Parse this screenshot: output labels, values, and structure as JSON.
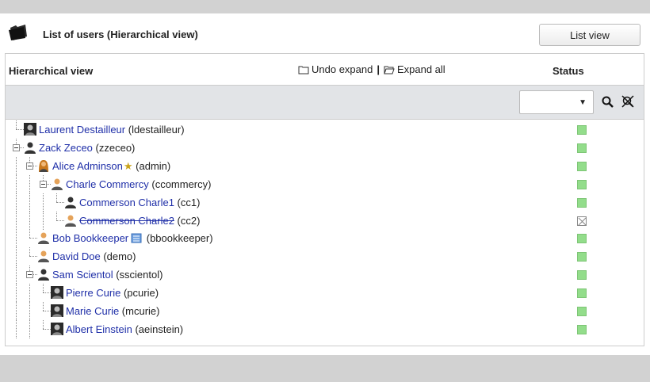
{
  "header": {
    "title": "List of users (Hierarchical view)",
    "list_view_label": "List view"
  },
  "table": {
    "col_hierarchical": "Hierarchical view",
    "undo_expand": "Undo expand",
    "separator": "|",
    "expand_all": "Expand all",
    "col_status": "Status",
    "status_filter_value": ""
  },
  "users": [
    {
      "name": "Laurent Destailleur",
      "login": "(ldestailleur)",
      "level": 0,
      "avatar": "photo-avatar-icon",
      "status": "enabled"
    },
    {
      "name": "Zack Zeceo",
      "login": "(zzeceo)",
      "level": 0,
      "avatar": "user-dark-icon",
      "status": "enabled",
      "expanded": true
    },
    {
      "name": "Alice Adminson",
      "login": "(admin)",
      "level": 1,
      "avatar": "user-female-icon",
      "status": "enabled",
      "expanded": true,
      "badge": "admin-star-icon"
    },
    {
      "name": "Charle Commercy",
      "login": "(ccommercy)",
      "level": 2,
      "avatar": "user-orange-icon",
      "status": "enabled",
      "expanded": true
    },
    {
      "name": "Commerson Charle1",
      "login": "(cc1)",
      "level": 3,
      "avatar": "user-dark-icon",
      "status": "enabled"
    },
    {
      "name": "Commerson Charle2",
      "login": "(cc2)",
      "level": 3,
      "avatar": "user-orange-icon",
      "status": "disabled"
    },
    {
      "name": "Bob Bookkeeper",
      "login": "(bbookkeeper)",
      "level": 1,
      "avatar": "user-orange-icon",
      "status": "enabled",
      "badge": "accountant-icon"
    },
    {
      "name": "David Doe",
      "login": "(demo)",
      "level": 1,
      "avatar": "user-orange-icon",
      "status": "enabled"
    },
    {
      "name": "Sam Scientol",
      "login": "(sscientol)",
      "level": 1,
      "avatar": "user-dark-icon",
      "status": "enabled",
      "expanded": true
    },
    {
      "name": "Pierre Curie",
      "login": "(pcurie)",
      "level": 2,
      "avatar": "photo-avatar-icon",
      "status": "enabled"
    },
    {
      "name": "Marie Curie",
      "login": "(mcurie)",
      "level": 2,
      "avatar": "photo-avatar-icon",
      "status": "enabled"
    },
    {
      "name": "Albert Einstein",
      "login": "(aeinstein)",
      "level": 2,
      "avatar": "photo-avatar-icon",
      "status": "enabled"
    }
  ],
  "colors": {
    "link": "#1f2fa8",
    "status_enabled": "#93dd8b",
    "filter_bg": "#e2e4e7",
    "frame_bg": "#d2d2d2"
  }
}
